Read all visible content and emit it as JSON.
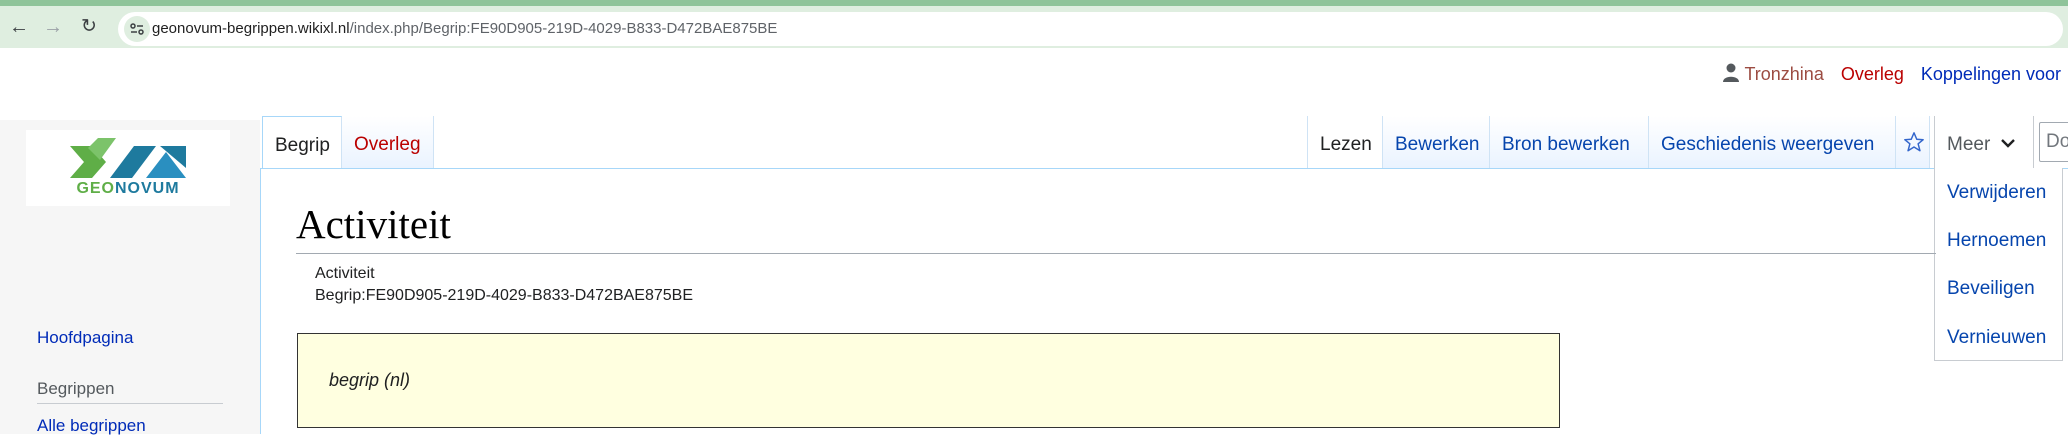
{
  "browser": {
    "url_host": "geonovum-begrippen.wikixl.nl",
    "url_path": "/index.php/Begrip:FE90D905-219D-4029-B833-D472BAE875BE"
  },
  "personal_tools": {
    "user": "Tronzhina",
    "talk": "Overleg",
    "links": "Koppelingen voor"
  },
  "logo": {
    "text_geo": "GEO",
    "text_novum": "NOVUM"
  },
  "sidebar": {
    "main_page": "Hoofdpagina",
    "section_heading": "Begrippen",
    "all_terms": "Alle begrippen"
  },
  "tabs": {
    "namespace": "Begrip",
    "talk": "Overleg",
    "read": "Lezen",
    "edit": "Bewerken",
    "edit_source": "Bron bewerken",
    "history": "Geschiedenis weergeven",
    "more": "Meer"
  },
  "search": {
    "placeholder": "Do"
  },
  "more_menu": [
    "Verwijderen",
    "Hernoemen",
    "Beveiligen",
    "Vernieuwen"
  ],
  "page": {
    "title": "Activiteit",
    "subtitle_name": "Activiteit",
    "subtitle_id": "Begrip:FE90D905-219D-4029-B833-D472BAE875BE",
    "infobox_label": "begrip (nl)"
  }
}
